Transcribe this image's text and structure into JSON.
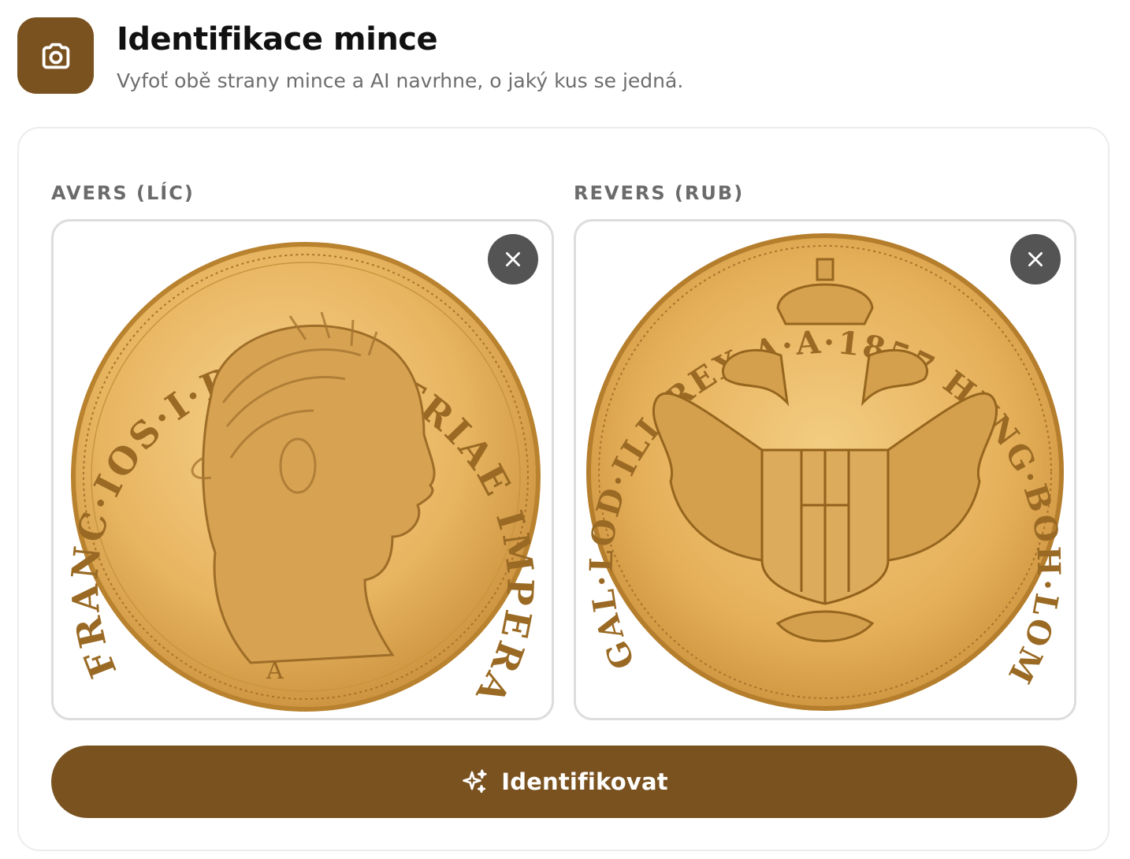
{
  "header": {
    "icon": "camera-icon",
    "title": "Identifikace mince",
    "subtitle": "Vyfoť obě strany mince a AI navrhne, o jaký kus se jedná."
  },
  "obverse": {
    "label": "AVERS (LÍC)",
    "remove_icon": "close-icon",
    "coin_legend": "FRANC·IOS·I·D·G·AVSTRIAE IMPERATOR",
    "mint_mark": "A"
  },
  "reverse": {
    "label": "REVERS (RUB)",
    "remove_icon": "close-icon",
    "coin_legend": "GAL·LOD·ILL·REX·A·A·1857 HVNG·BOH·LOMB·ET·VEN·"
  },
  "action": {
    "icon": "sparkles-icon",
    "label": "Identifikovat"
  },
  "colors": {
    "accent": "#7a5220",
    "remove_button": "#545454",
    "gold_light": "#f2c878",
    "gold_dark": "#b27a2c"
  }
}
